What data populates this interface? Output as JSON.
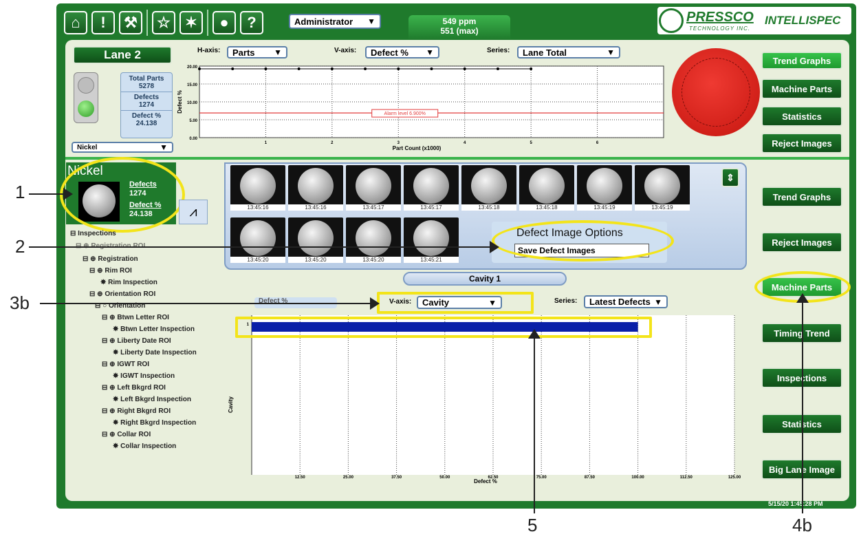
{
  "topbar": {
    "icons": [
      "home-icon",
      "alert-icon",
      "wrench-icon",
      "star-icon",
      "wand-icon",
      "globe-icon",
      "help-icon"
    ],
    "user": "Administrator",
    "speed_line1": "549 ppm",
    "speed_line2": "551 (max)",
    "brand_main": "PRESSCO",
    "brand_sub": "TECHNOLOGY INC.",
    "product": "INTELLISPEC"
  },
  "lane": {
    "title": "Lane 2",
    "total_parts_label": "Total Parts",
    "total_parts": "5278",
    "defects_label": "Defects",
    "defects": "1274",
    "defect_pct_label": "Defect %",
    "defect_pct": "24.138",
    "product_select": "Nickel"
  },
  "trend": {
    "haxis_label": "H-axis:",
    "haxis_value": "Parts",
    "vaxis_label": "V-axis:",
    "vaxis_value": "Defect %",
    "series_label": "Series:",
    "series_value": "Lane Total",
    "ylabel": "Defect %",
    "xlabel": "Part Count (x1000)",
    "alarm_label": "Alarm level 6.900%",
    "yticks": [
      "20.00",
      "15.00",
      "10.00",
      "5.00",
      "0.00"
    ],
    "xticks": [
      "1",
      "2",
      "3",
      "4",
      "5",
      "6"
    ]
  },
  "right_top": {
    "buttons": [
      "Trend Graphs",
      "Machine Parts",
      "Statistics",
      "Reject Images"
    ]
  },
  "right_bottom": {
    "buttons": [
      "Trend Graphs",
      "Reject Images",
      "Machine Parts",
      "Timing Trend",
      "Inspections",
      "Statistics",
      "Big Lane Image"
    ],
    "datetime": "5/15/20  1:45:28 PM"
  },
  "nickel_panel": {
    "name": "Nickel",
    "defects_label": "Defects",
    "defects": "1274",
    "pct_label": "Defect %",
    "pct": "24.138"
  },
  "thumbnails": {
    "row1": [
      "13:45:16",
      "13:45:16",
      "13:45:17",
      "13:45:17",
      "13:45:18",
      "13:45:18",
      "13:45:19",
      "13:45:19"
    ],
    "row2": [
      "13:45:20",
      "13:45:20",
      "13:45:20",
      "13:45:21"
    ],
    "options_title": "Defect Image Options",
    "save_label": "Save Defect Images"
  },
  "tree": {
    "items": [
      "Inspections",
      "Registration ROI",
      "Registration",
      "Rim ROI",
      "Rim Inspection",
      "Orientation ROI",
      "Orientation",
      "Btwn Letter ROI",
      "Btwn Letter Inspection",
      "Liberty Date ROI",
      "Liberty Date Inspection",
      "IGWT ROI",
      "IGWT Inspection",
      "Left Bkgrd ROI",
      "Left Bkgrd Inspection",
      "Right Bkgrd ROI",
      "Right Bkgrd Inspection",
      "Collar ROI",
      "Collar Inspection"
    ]
  },
  "cavity": {
    "tab": "Cavity 1",
    "hidden_tab": "Defect %",
    "vaxis_label": "V-axis:",
    "vaxis_value": "Cavity",
    "series_label": "Series:",
    "series_value": "Latest Defects",
    "ylabel": "Cavity",
    "xlabel": "Defect %",
    "xticks": [
      "12.50",
      "25.00",
      "37.50",
      "50.00",
      "62.50",
      "75.00",
      "87.50",
      "100.00",
      "112.50",
      "125.00"
    ],
    "bar_label": "1"
  },
  "callouts": {
    "c1": "1",
    "c2": "2",
    "c3b": "3b",
    "c4b": "4b",
    "c5": "5"
  },
  "chart_data": [
    {
      "type": "line",
      "x": [
        0.0,
        0.5,
        1.0,
        1.5,
        2.0,
        2.5,
        3.0,
        3.5,
        4.0,
        4.5,
        5.0
      ],
      "values": [
        24.1,
        24.1,
        24.1,
        24.1,
        24.1,
        24.1,
        24.1,
        24.1,
        24.1,
        24.1,
        24.1
      ],
      "alarm": 6.9,
      "ylim": [
        0,
        20
      ],
      "xlim": [
        0,
        7
      ],
      "xlabel": "Part Count (x1000)",
      "ylabel": "Defect %"
    },
    {
      "type": "bar",
      "categories": [
        "1"
      ],
      "values": [
        100
      ],
      "xlim": [
        0,
        125
      ],
      "xlabel": "Defect %",
      "ylabel": "Cavity"
    }
  ],
  "colors": {
    "frame": "#1f7a2c",
    "panel": "#e9efdc",
    "highlight": "#f3e41a",
    "bar": "#0a1fa8",
    "alarm": "#e23b3b",
    "coin_red": "#e62a22"
  }
}
